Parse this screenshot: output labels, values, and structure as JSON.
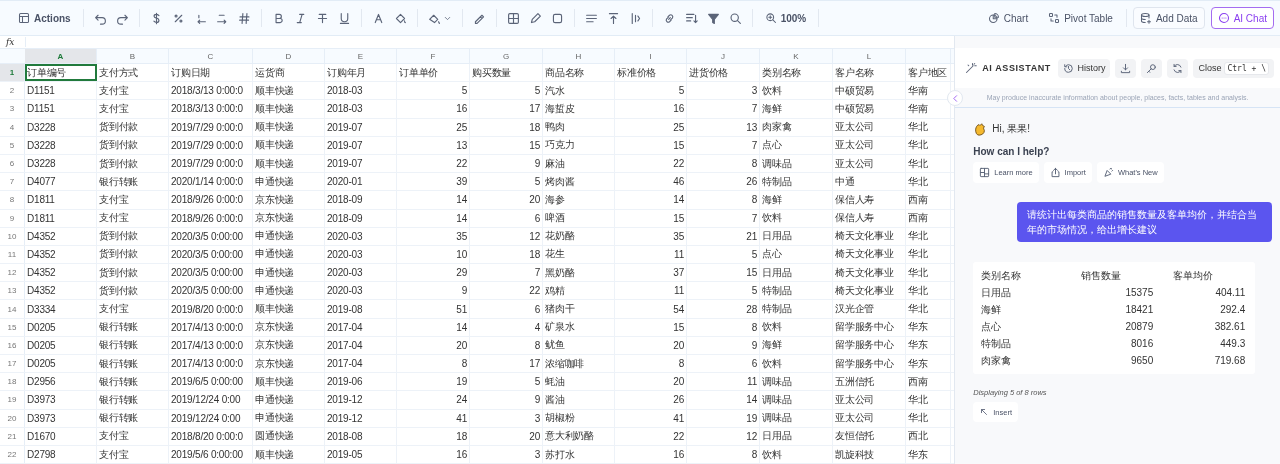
{
  "toolbar": {
    "actions": "Actions",
    "zoom": "100%"
  },
  "top_actions": [
    {
      "label": "Chart",
      "kind": "plain",
      "selected": false
    },
    {
      "label": "Pivot Table",
      "kind": "plain",
      "selected": false
    },
    {
      "label": "Add Data",
      "kind": "outlined",
      "selected": false
    },
    {
      "label": "AI Chat",
      "kind": "outlined",
      "selected": true
    }
  ],
  "formula_bar": {
    "label": "fx"
  },
  "sheet": {
    "columns": [
      {
        "letter": "A",
        "kind": "text",
        "selected": true
      },
      {
        "letter": "B",
        "kind": "text",
        "selected": false
      },
      {
        "letter": "C",
        "kind": "text",
        "selected": false
      },
      {
        "letter": "D",
        "kind": "text",
        "selected": false
      },
      {
        "letter": "E",
        "kind": "text",
        "selected": false
      },
      {
        "letter": "F",
        "kind": "number",
        "selected": false
      },
      {
        "letter": "G",
        "kind": "number",
        "selected": false
      },
      {
        "letter": "H",
        "kind": "text",
        "selected": false
      },
      {
        "letter": "I",
        "kind": "number",
        "selected": false
      },
      {
        "letter": "J",
        "kind": "number",
        "selected": false
      },
      {
        "letter": "K",
        "kind": "text",
        "selected": false
      },
      {
        "letter": "L",
        "kind": "text",
        "selected": false
      },
      {
        "kind": "text",
        "selected": false
      }
    ],
    "rows": [
      {
        "number": "1",
        "selected": true,
        "kind": "header",
        "cells": [
          "订单编号",
          "支付方式",
          "订购日期",
          "运货商",
          "订购年月",
          "订单单价",
          "购买数量",
          "商品名称",
          "标准价格",
          "进货价格",
          "类别名称",
          "客户名称",
          "客户地区"
        ]
      },
      {
        "number": "2",
        "selected": false,
        "kind": "data",
        "cells": [
          "D1151",
          "支付宝",
          "2018/3/13 0:00:0",
          "顺丰快递",
          "2018-03",
          "5",
          "5",
          "汽水",
          "5",
          "3",
          "饮料",
          "中硕贸易",
          "华南"
        ]
      },
      {
        "number": "3",
        "selected": false,
        "kind": "data",
        "cells": [
          "D1151",
          "支付宝",
          "2018/3/13 0:00:0",
          "顺丰快递",
          "2018-03",
          "16",
          "17",
          "海蜇皮",
          "16",
          "7",
          "海鲜",
          "中硕贸易",
          "华南"
        ]
      },
      {
        "number": "4",
        "selected": false,
        "kind": "data",
        "cells": [
          "D3228",
          "货到付款",
          "2019/7/29 0:00:0",
          "顺丰快递",
          "2019-07",
          "25",
          "18",
          "鸭肉",
          "25",
          "13",
          "肉家禽",
          "亚太公司",
          "华北"
        ]
      },
      {
        "number": "5",
        "selected": false,
        "kind": "data",
        "cells": [
          "D3228",
          "货到付款",
          "2019/7/29 0:00:0",
          "顺丰快递",
          "2019-07",
          "13",
          "15",
          "巧克力",
          "15",
          "7",
          "点心",
          "亚太公司",
          "华北"
        ]
      },
      {
        "number": "6",
        "selected": false,
        "kind": "data",
        "cells": [
          "D3228",
          "货到付款",
          "2019/7/29 0:00:0",
          "顺丰快递",
          "2019-07",
          "22",
          "9",
          "麻油",
          "22",
          "8",
          "调味品",
          "亚太公司",
          "华北"
        ]
      },
      {
        "number": "7",
        "selected": false,
        "kind": "data",
        "cells": [
          "D4077",
          "银行转账",
          "2020/1/14 0:00:0",
          "申通快递",
          "2020-01",
          "39",
          "5",
          "烤肉酱",
          "46",
          "26",
          "特制品",
          "中通",
          "华北"
        ]
      },
      {
        "number": "8",
        "selected": false,
        "kind": "data",
        "cells": [
          "D1811",
          "支付宝",
          "2018/9/26 0:00:0",
          "京东快递",
          "2018-09",
          "14",
          "20",
          "海参",
          "14",
          "8",
          "海鲜",
          "保信人寿",
          "西南"
        ]
      },
      {
        "number": "9",
        "selected": false,
        "kind": "data",
        "cells": [
          "D1811",
          "支付宝",
          "2018/9/26 0:00:0",
          "京东快递",
          "2018-09",
          "14",
          "6",
          "啤酒",
          "15",
          "7",
          "饮料",
          "保信人寿",
          "西南"
        ]
      },
      {
        "number": "10",
        "selected": false,
        "kind": "data",
        "cells": [
          "D4352",
          "货到付款",
          "2020/3/5 0:00:00",
          "申通快递",
          "2020-03",
          "35",
          "12",
          "花奶酪",
          "35",
          "21",
          "日用品",
          "椅天文化事业",
          "华北"
        ]
      },
      {
        "number": "11",
        "selected": false,
        "kind": "data",
        "cells": [
          "D4352",
          "货到付款",
          "2020/3/5 0:00:00",
          "申通快递",
          "2020-03",
          "10",
          "18",
          "花生",
          "11",
          "5",
          "点心",
          "椅天文化事业",
          "华北"
        ]
      },
      {
        "number": "12",
        "selected": false,
        "kind": "data",
        "cells": [
          "D4352",
          "货到付款",
          "2020/3/5 0:00:00",
          "申通快递",
          "2020-03",
          "29",
          "7",
          "黑奶酪",
          "37",
          "15",
          "日用品",
          "椅天文化事业",
          "华北"
        ]
      },
      {
        "number": "13",
        "selected": false,
        "kind": "data",
        "cells": [
          "D4352",
          "货到付款",
          "2020/3/5 0:00:00",
          "申通快递",
          "2020-03",
          "9",
          "22",
          "鸡精",
          "11",
          "5",
          "特制品",
          "椅天文化事业",
          "华北"
        ]
      },
      {
        "number": "14",
        "selected": false,
        "kind": "data",
        "cells": [
          "D3334",
          "支付宝",
          "2019/8/20 0:00:0",
          "顺丰快递",
          "2019-08",
          "51",
          "6",
          "猪肉干",
          "54",
          "28",
          "特制品",
          "汉光企管",
          "华北"
        ]
      },
      {
        "number": "15",
        "selected": false,
        "kind": "data",
        "cells": [
          "D0205",
          "银行转账",
          "2017/4/13 0:00:0",
          "京东快递",
          "2017-04",
          "14",
          "4",
          "矿泉水",
          "15",
          "8",
          "饮料",
          "留学服务中心",
          "华东"
        ]
      },
      {
        "number": "16",
        "selected": false,
        "kind": "data",
        "cells": [
          "D0205",
          "银行转账",
          "2017/4/13 0:00:0",
          "京东快递",
          "2017-04",
          "20",
          "8",
          "鱿鱼",
          "20",
          "9",
          "海鲜",
          "留学服务中心",
          "华东"
        ]
      },
      {
        "number": "17",
        "selected": false,
        "kind": "data",
        "cells": [
          "D0205",
          "银行转账",
          "2017/4/13 0:00:0",
          "京东快递",
          "2017-04",
          "8",
          "17",
          "浓缩咖啡",
          "8",
          "6",
          "饮料",
          "留学服务中心",
          "华东"
        ]
      },
      {
        "number": "18",
        "selected": false,
        "kind": "data",
        "cells": [
          "D2956",
          "银行转账",
          "2019/6/5 0:00:00",
          "顺丰快递",
          "2019-06",
          "19",
          "5",
          "蚝油",
          "20",
          "11",
          "调味品",
          "五洲信托",
          "西南"
        ]
      },
      {
        "number": "19",
        "selected": false,
        "kind": "data",
        "cells": [
          "D3973",
          "银行转账",
          "2019/12/24 0:00",
          "申通快递",
          "2019-12",
          "24",
          "9",
          "酱油",
          "26",
          "14",
          "调味品",
          "亚太公司",
          "华北"
        ]
      },
      {
        "number": "20",
        "selected": false,
        "kind": "data",
        "cells": [
          "D3973",
          "银行转账",
          "2019/12/24 0:00",
          "申通快递",
          "2019-12",
          "41",
          "3",
          "胡椒粉",
          "41",
          "19",
          "调味品",
          "亚太公司",
          "华北"
        ]
      },
      {
        "number": "21",
        "selected": false,
        "kind": "data",
        "cells": [
          "D1670",
          "支付宝",
          "2018/8/20 0:00:0",
          "圆通快递",
          "2018-08",
          "18",
          "20",
          "意大利奶酪",
          "22",
          "12",
          "日用品",
          "友恒信托",
          "西北"
        ]
      },
      {
        "number": "22",
        "selected": false,
        "kind": "data",
        "cells": [
          "D2798",
          "支付宝",
          "2019/5/6 0:00:00",
          "顺丰快递",
          "2019-05",
          "16",
          "3",
          "苏打水",
          "16",
          "8",
          "饮料",
          "凯旋科技",
          "华东"
        ]
      }
    ]
  },
  "assistant": {
    "title": "AI ASSISTANT",
    "buttons": [
      {
        "kind": "history",
        "label": "History"
      },
      {
        "kind": "download"
      },
      {
        "kind": "key"
      },
      {
        "kind": "refresh"
      }
    ],
    "close": {
      "label": "Close",
      "shortcut": "Ctrl + \\"
    },
    "disclaimer": "May produce inaccurate information about people, places, facts, tables and analysis.",
    "greeting": "Hi, 果果!",
    "prompt": "How can I help?",
    "chips": [
      {
        "kind": "learn",
        "label": "Learn more"
      },
      {
        "kind": "import",
        "label": "Import"
      },
      {
        "kind": "news",
        "label": "What's New"
      }
    ],
    "user_message": "请统计出每类商品的销售数量及客单均价，并结合当年的市场情况，给出增长建议",
    "result": {
      "columns": [
        "类别名称",
        "销售数量",
        "客单均价"
      ],
      "rows": [
        [
          "日用品",
          "15375",
          "404.11"
        ],
        [
          "海鲜",
          "18421",
          "292.4"
        ],
        [
          "点心",
          "20879",
          "382.61"
        ],
        [
          "特制品",
          "8016",
          "449.3"
        ],
        [
          "肉家禽",
          "9650",
          "719.68"
        ]
      ]
    },
    "footer": "Displaying 5 of 8 rows",
    "insert": "Insert"
  }
}
